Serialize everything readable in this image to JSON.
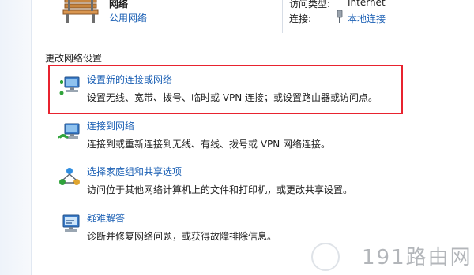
{
  "network": {
    "name": "网络",
    "type": "公用网络"
  },
  "access_info": {
    "access_type_label": "访问类型:",
    "access_type_value": "Internet",
    "connection_label": "连接:",
    "connection_value": "本地连接"
  },
  "section": {
    "title": "更改网络设置"
  },
  "tasks": [
    {
      "title": "设置新的连接或网络",
      "description": "设置无线、宽带、拨号、临时或 VPN 连接；或设置路由器或访问点。",
      "icon": "new-connection-icon"
    },
    {
      "title": "连接到网络",
      "description": "连接到或重新连接到无线、有线、拨号或 VPN 网络连接。",
      "icon": "connect-network-icon"
    },
    {
      "title": "选择家庭组和共享选项",
      "description": "访问位于其他网络计算机上的文件和打印机，或更改共享设置。",
      "icon": "homegroup-icon"
    },
    {
      "title": "疑难解答",
      "description": "诊断并修复网络问题，或获得故障排除信息。",
      "icon": "troubleshoot-icon"
    }
  ],
  "watermark": "191路由网",
  "colors": {
    "link": "#1a5fb4",
    "highlight_border": "#e8232f",
    "watermark": "#b3b6ba"
  }
}
